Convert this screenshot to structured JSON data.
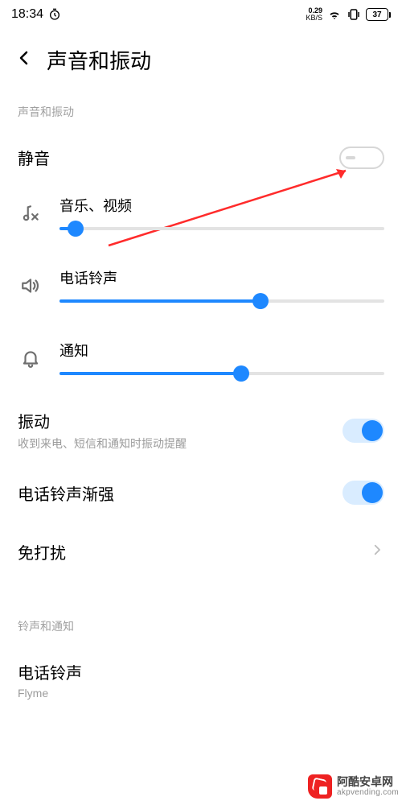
{
  "status": {
    "time": "18:34",
    "net_rate_top": "0.29",
    "net_rate_bot": "KB/S",
    "battery": "37"
  },
  "header": {
    "title": "声音和振动"
  },
  "sections": {
    "sound_vibration_label": "声音和振动",
    "ringtone_notif_label": "铃声和通知"
  },
  "mute": {
    "label": "静音"
  },
  "sliders": {
    "media": {
      "label": "音乐、视频",
      "value_pct": 5
    },
    "ring": {
      "label": "电话铃声",
      "value_pct": 62
    },
    "notif": {
      "label": "通知",
      "value_pct": 56
    }
  },
  "toggles": {
    "vibration": {
      "label": "振动",
      "sub": "收到来电、短信和通知时振动提醒",
      "on": true
    },
    "ring_fadein": {
      "label": "电话铃声渐强",
      "on": true
    }
  },
  "dnd": {
    "label": "免打扰"
  },
  "ringtone": {
    "label": "电话铃声",
    "value": "Flyme"
  },
  "watermark": {
    "cn": "阿酷安卓网",
    "en": "akpvending.com"
  }
}
